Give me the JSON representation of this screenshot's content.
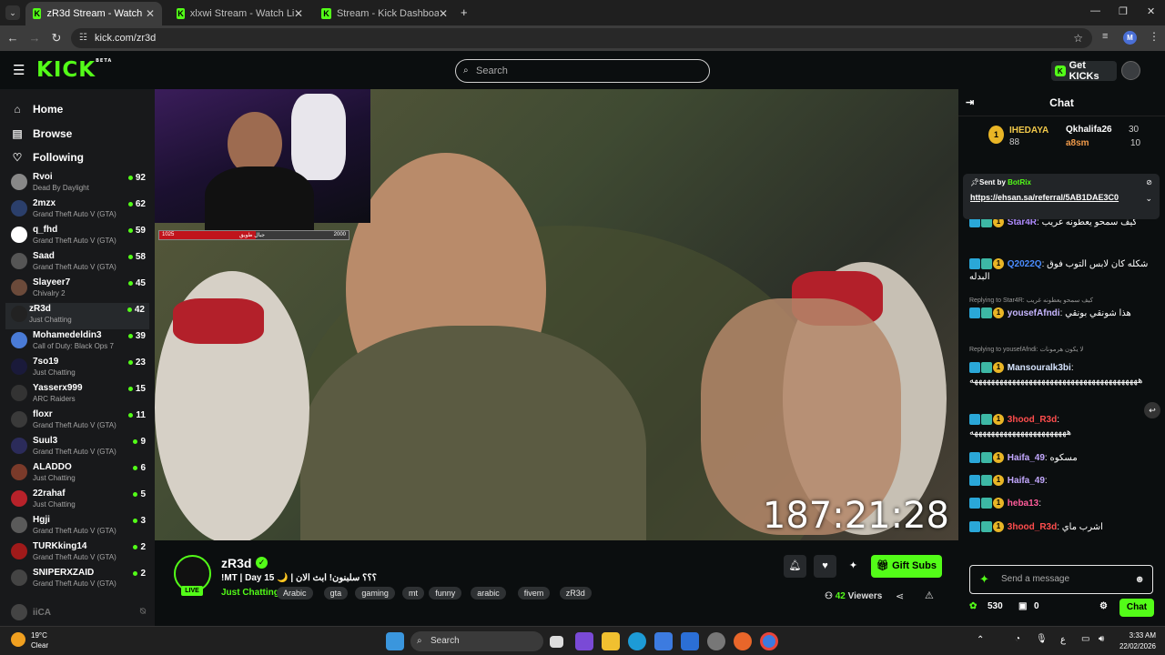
{
  "browser": {
    "tabs": [
      {
        "title": "zR3d Stream - Watch Live o",
        "active": true
      },
      {
        "title": "xlxwi Stream - Watch Live on Ki",
        "active": false
      },
      {
        "title": "Stream - Kick Dashboard",
        "active": false
      }
    ],
    "url": "kick.com/zr3d",
    "profile_initial": "M"
  },
  "header": {
    "logo": "KICK",
    "logo_sup": "BETA",
    "search_placeholder": "Search",
    "get_kicks": "Get KICKs"
  },
  "sidebar": {
    "nav": [
      {
        "label": "Home",
        "icon": "home-icon"
      },
      {
        "label": "Browse",
        "icon": "browse-icon"
      },
      {
        "label": "Following",
        "icon": "heart-icon"
      }
    ],
    "channels": [
      {
        "name": "Rvoi",
        "game": "Dead By Daylight",
        "viewers": "92",
        "color": "#888888"
      },
      {
        "name": "2mzx",
        "game": "Grand Theft Auto V (GTA)",
        "viewers": "62",
        "color": "#2b3f6b"
      },
      {
        "name": "q_fhd",
        "game": "Grand Theft Auto V (GTA)",
        "viewers": "59",
        "color": "#ffffff"
      },
      {
        "name": "Saad",
        "game": "Grand Theft Auto V (GTA)",
        "viewers": "58",
        "color": "#555555"
      },
      {
        "name": "Slayeer7",
        "game": "Chivalry 2",
        "viewers": "45",
        "color": "#6b4a3a"
      },
      {
        "name": "zR3d",
        "game": "Just Chatting",
        "viewers": "42",
        "color": "#222222",
        "selected": true
      },
      {
        "name": "Mohamedeldin3",
        "game": "Call of Duty: Black Ops 7",
        "viewers": "39",
        "color": "#4a7bd6"
      },
      {
        "name": "7so19",
        "game": "Just Chatting",
        "viewers": "23",
        "color": "#1a1a3a"
      },
      {
        "name": "Yasserx999",
        "game": "ARC Raiders",
        "viewers": "15",
        "color": "#333333"
      },
      {
        "name": "floxr",
        "game": "Grand Theft Auto V (GTA)",
        "viewers": "11",
        "color": "#3a3a3a"
      },
      {
        "name": "Suul3",
        "game": "Grand Theft Auto V (GTA)",
        "viewers": "9",
        "color": "#2b2b5a"
      },
      {
        "name": "ALADDO",
        "game": "Just Chatting",
        "viewers": "6",
        "color": "#7a3a2a"
      },
      {
        "name": "22rahaf",
        "game": "Just Chatting",
        "viewers": "5",
        "color": "#b8222a"
      },
      {
        "name": "Hgji",
        "game": "Grand Theft Auto V (GTA)",
        "viewers": "3",
        "color": "#5a5a5a"
      },
      {
        "name": "TURKking14",
        "game": "Grand Theft Auto V (GTA)",
        "viewers": "2",
        "color": "#a01a1a"
      },
      {
        "name": "SNIPERXZAID",
        "game": "Grand Theft Auto V (GTA)",
        "viewers": "2",
        "color": "#444444"
      }
    ],
    "offline_name": "iiCA"
  },
  "video": {
    "timer": "187:21:28",
    "hp_left": "1025",
    "hp_right": "2000",
    "hp_label": "جبال طويق",
    "hp_fraction": 0.51
  },
  "stream": {
    "name": "zR3d",
    "title": "!MT | Day 15 🌙 | ؟؟؟ سلبنون! ابث الان",
    "category": "Just Chatting",
    "tags": [
      "Arabic",
      "gta",
      "gaming",
      "mt",
      "funny",
      "arabic",
      "fivem",
      "zR3d"
    ],
    "live_label": "LIVE",
    "gift_subs": "Gift Subs",
    "viewers_count": "42",
    "viewers_label": "Viewers"
  },
  "chat": {
    "title": "Chat",
    "leaderboard": [
      {
        "name": "IHEDAYA",
        "value": "88"
      },
      {
        "name": "Qkhalifa26",
        "value": "30"
      },
      {
        "name": "a8sm",
        "value": "10"
      }
    ],
    "pinned": {
      "sent_by": "Sent by",
      "bot": "BotRix",
      "link": "https://ehsan.sa/referral/5AB1DAE3C0"
    },
    "messages": [
      {
        "user": "Star4R",
        "text": "كيف سمحو يعطونه غريب",
        "color": "#b08cff"
      },
      {
        "user": "Q2022Q",
        "text": "شكله كان لابس التوب فوق البدله",
        "color": "#4a8cff"
      },
      {
        "reply": "Replying to Star4R: كيف سمحو يعطونه غريب"
      },
      {
        "user": "yousefAfndi",
        "text": "هذا شونقي بونقي",
        "color": "#c7b6ff"
      },
      {
        "reply": "Replying to yousefAfndi: لا يكون هرمونات"
      },
      {
        "user": "Mansouralk3bi",
        "text": "ههههههههههههههههههههههههههههههههههههههههه",
        "color": "#d6e4ff"
      },
      {
        "user": "3hood_R3d",
        "text": "هههههههههههههههههههههههه",
        "color": "#ff4d4d"
      },
      {
        "user": "Haifa_49",
        "text": "مسكوه",
        "color": "#c3a8ff"
      },
      {
        "user": "Haifa_49",
        "text": "",
        "color": "#c3a8ff"
      },
      {
        "user": "heba13",
        "text": "",
        "color": "#ff5c9a"
      },
      {
        "user": "3hood_R3d",
        "text": "اشرب ماي",
        "color": "#ff4d4d"
      }
    ],
    "input_placeholder": "Send a message",
    "points": "530",
    "gifts": "0",
    "chat_button": "Chat"
  },
  "taskbar": {
    "weather_temp": "19°C",
    "weather_desc": "Clear",
    "search": "Search",
    "lang": "ع",
    "time": "3:33 AM",
    "date": "22/02/2026"
  }
}
